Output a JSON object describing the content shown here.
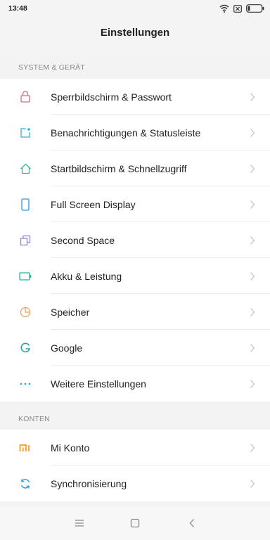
{
  "status": {
    "time": "13:48",
    "icons": [
      "wifi-icon",
      "sim-off-icon",
      "battery-icon"
    ]
  },
  "header": {
    "title": "Einstellungen"
  },
  "sections": [
    {
      "title": "SYSTEM & GERÄT",
      "items": [
        {
          "label": "Sperrbildschirm & Passwort",
          "icon": "lock-icon",
          "color": "#e0697a"
        },
        {
          "label": "Benachrichtigungen & Statusleiste",
          "icon": "notification-icon",
          "color": "#2bb1d9"
        },
        {
          "label": "Startbildschirm & Schnellzugriff",
          "icon": "home-icon",
          "color": "#28b9a2"
        },
        {
          "label": "Full Screen Display",
          "icon": "phone-icon",
          "color": "#2d8fe2"
        },
        {
          "label": "Second Space",
          "icon": "second-space-icon",
          "color": "#9b84c7"
        },
        {
          "label": "Akku & Leistung",
          "icon": "battery-icon",
          "color": "#27b49c"
        },
        {
          "label": "Speicher",
          "icon": "pie-chart-icon",
          "color": "#f0a05a"
        },
        {
          "label": "Google",
          "icon": "google-icon",
          "color": "#2aa39a"
        },
        {
          "label": "Weitere Einstellungen",
          "icon": "more-icon",
          "color": "#2fb5d9"
        }
      ]
    },
    {
      "title": "KONTEN",
      "items": [
        {
          "label": "Mi Konto",
          "icon": "mi-logo-icon",
          "color": "#f39a2b"
        },
        {
          "label": "Synchronisierung",
          "icon": "sync-icon",
          "color": "#2d9be0"
        }
      ]
    }
  ],
  "navbar": {
    "buttons": [
      "menu-icon",
      "home-square-icon",
      "back-icon"
    ]
  }
}
